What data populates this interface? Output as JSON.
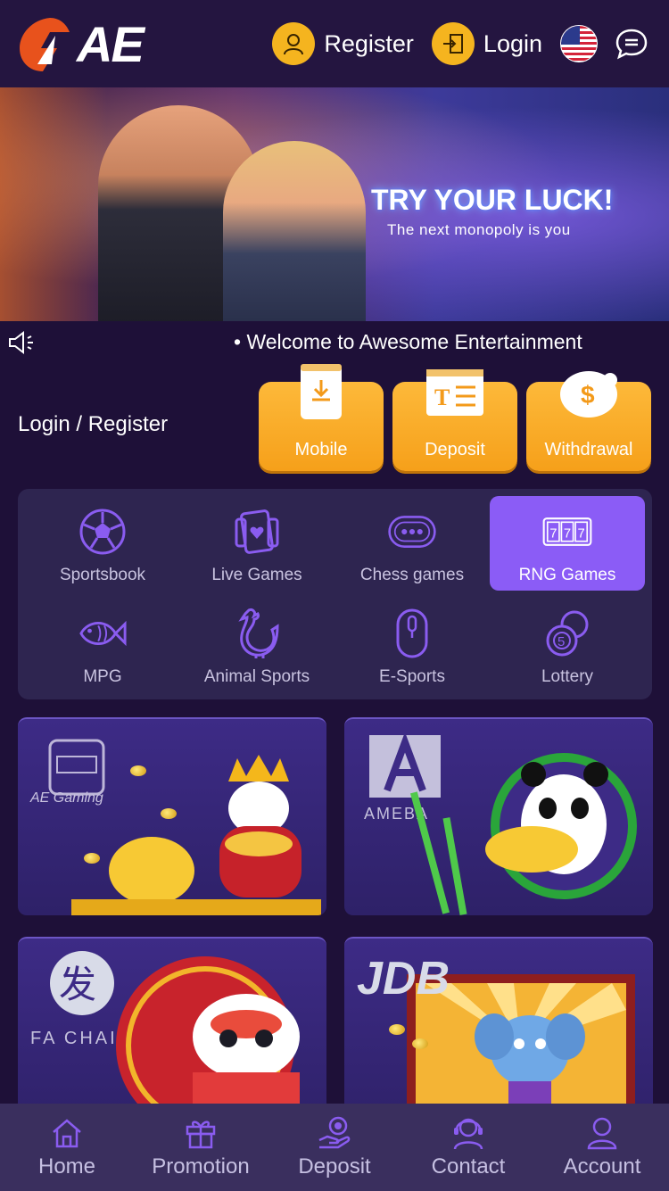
{
  "header": {
    "logo_text": "AE",
    "register_label": "Register",
    "login_label": "Login"
  },
  "banner": {
    "title": "TRY YOUR LUCK!",
    "subtitle": "The next monopoly is you"
  },
  "marquee": {
    "text": "• Welcome to Awesome Entertainment"
  },
  "quick": {
    "login_register": "Login / Register",
    "buttons": [
      {
        "label": "Mobile",
        "icon": "download-phone-icon"
      },
      {
        "label": "Deposit",
        "icon": "deposit-card-icon"
      },
      {
        "label": "Withdrawal",
        "icon": "piggy-bank-icon"
      }
    ]
  },
  "categories": [
    {
      "label": "Sportsbook",
      "icon": "soccer-ball-icon"
    },
    {
      "label": "Live Games",
      "icon": "cards-icon"
    },
    {
      "label": "Chess games",
      "icon": "chips-icon"
    },
    {
      "label": "RNG Games",
      "icon": "slot-777-icon",
      "active": true
    },
    {
      "label": "MPG",
      "icon": "fish-icon"
    },
    {
      "label": "Animal Sports",
      "icon": "rooster-icon"
    },
    {
      "label": "E-Sports",
      "icon": "mouse-icon"
    },
    {
      "label": "Lottery",
      "icon": "lottery-ball-icon"
    }
  ],
  "games": [
    {
      "brand": "AE Gaming"
    },
    {
      "brand": "AMEBA"
    },
    {
      "brand": "FA CHAI"
    },
    {
      "brand": "JDB"
    }
  ],
  "bottom_nav": [
    {
      "label": "Home",
      "icon": "home-icon"
    },
    {
      "label": "Promotion",
      "icon": "gift-icon"
    },
    {
      "label": "Deposit",
      "icon": "deposit-hand-icon"
    },
    {
      "label": "Contact",
      "icon": "headset-icon"
    },
    {
      "label": "Account",
      "icon": "user-icon"
    }
  ],
  "colors": {
    "background": "#1e1038",
    "header": "#241540",
    "accent_gold": "#f5b41f",
    "active_purple": "#8b5cf6",
    "panel": "#2e2550",
    "nav": "#3a2f5e"
  }
}
